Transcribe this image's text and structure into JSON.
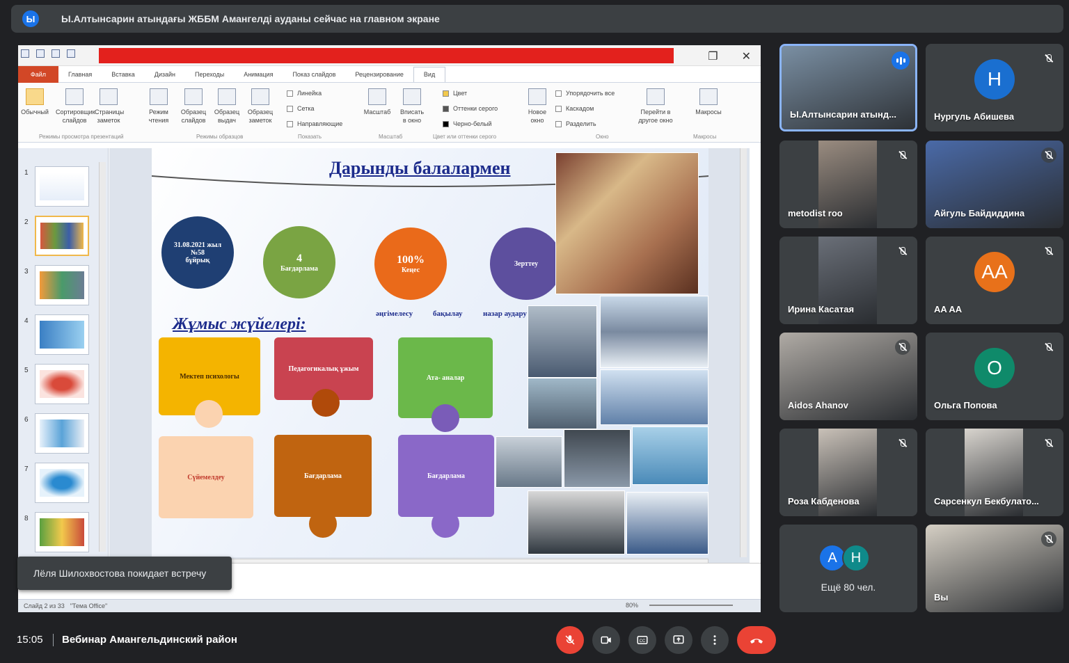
{
  "banner": {
    "avatar_letter": "Ы",
    "text": "Ы.Алтынсарин атындағы ЖББМ Амангелді ауданы сейчас на главном экране"
  },
  "ppt": {
    "tabs": [
      "Файл",
      "Главная",
      "Вставка",
      "Дизайн",
      "Переходы",
      "Анимация",
      "Показ слайдов",
      "Рецензирование",
      "Вид"
    ],
    "active_tab": "Вид",
    "ribbon": {
      "normal": "Обычный",
      "sorter": "Сортировщик слайдов",
      "notes_page": "Страницы заметок",
      "reading": "Режим чтения",
      "slide_master": "Образец слайдов",
      "handout_master": "Образец выдач",
      "notes_master": "Образец заметок",
      "ruler": "Линейка",
      "grid": "Сетка",
      "guides": "Направляющие",
      "zoom": "Масштаб",
      "fit": "Вписать в окно",
      "color": "Цвет",
      "grayscale": "Оттенки серого",
      "bw": "Черно-белый",
      "new_window": "Новое окно",
      "arrange": "Упорядочить все",
      "cascade": "Каскадом",
      "split": "Разделить",
      "switch": "Перейти в другое окно",
      "macros": "Макросы",
      "group_views": "Режимы просмотра презентаций",
      "group_masters": "Режимы образцов",
      "group_show": "Показать",
      "group_zoom": "Масштаб",
      "group_color": "Цвет или оттенки серого",
      "group_window": "Окно",
      "group_macros": "Макросы"
    },
    "thumb_numbers": [
      "1",
      "2",
      "3",
      "4",
      "5",
      "6",
      "7",
      "8"
    ],
    "slide": {
      "title": "Дарынды балалармен",
      "drop1_line1": "31.08.2021 жыл",
      "drop1_line2": "№58",
      "drop1_line3": "бұйрық",
      "drop2_big": "4",
      "drop2_text": "Бағдарлама",
      "drop3_big": "100%",
      "drop3_text": "Кеңес",
      "drop4_text": "Зерттеу",
      "caption1": "әңгімелесу",
      "caption2": "бақылау",
      "caption3": "назар аудару",
      "subtitle": "Жұмыс жүйелері:",
      "piece1": "Мектеп психологы",
      "piece2": "Педагогикалық ұжым",
      "piece3": "Ата- аналар",
      "piece4": "Сүйемелдеу",
      "piece5": "Бағдарлама",
      "piece6": "Бағдарлама"
    },
    "status": {
      "slide": "Слайд 2 из 33",
      "theme": "\"Тема Office\"",
      "zoom": "80%"
    }
  },
  "toast": "Лёля Шилохвостова покидает встречу",
  "tiles": [
    {
      "name": "Ы.Алтынсарин атынд...",
      "type": "video",
      "active": true,
      "muted": false,
      "bg": "#7a8fa3"
    },
    {
      "name": "Нургуль Абишева",
      "type": "avatar",
      "letter": "Н",
      "color": "#1a6fd0",
      "muted": true
    },
    {
      "name": "metodist roo",
      "type": "video",
      "muted": true,
      "bg": "#9a8c80"
    },
    {
      "name": "Айгуль Байдиддина",
      "type": "video",
      "muted": true,
      "bg": "#4a6aa8"
    },
    {
      "name": "Ирина Касатая",
      "type": "video",
      "muted": true,
      "bg": "#6a6f78"
    },
    {
      "name": "AA AA",
      "type": "avatar",
      "letter": "AA",
      "color": "#e8711a",
      "muted": true
    },
    {
      "name": "Aidos Ahanov",
      "type": "video",
      "muted": true,
      "bg": "#b0aba5"
    },
    {
      "name": "Ольга Попова",
      "type": "avatar",
      "letter": "О",
      "color": "#0f8a6a",
      "muted": true
    },
    {
      "name": "Роза Кабденова",
      "type": "video",
      "muted": true,
      "bg": "#c9c1b8"
    },
    {
      "name": "Сарсенкул Бекбулато...",
      "type": "video",
      "muted": true,
      "bg": "#d8d4ce"
    },
    {
      "name": "Ещё 80 чел.",
      "type": "more",
      "letters": [
        "А",
        "Н"
      ],
      "colors": [
        "#1a73e8",
        "#0f8a8a"
      ]
    },
    {
      "name": "Вы",
      "type": "video",
      "muted": true,
      "bg": "#d5cfc4"
    }
  ],
  "bottom": {
    "time": "15:05",
    "meeting": "Вебинар Амангельдинский район"
  },
  "colors": {
    "bg": "#202124",
    "tile": "#3c4043",
    "accent": "#8ab4f8",
    "danger": "#ea4335"
  }
}
